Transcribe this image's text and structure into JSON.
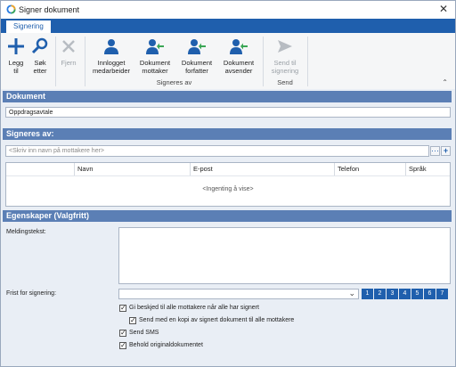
{
  "window": {
    "title": "Signer dokument",
    "close_glyph": "✕"
  },
  "tab": {
    "label": "Signering"
  },
  "ribbon": {
    "buttons": [
      {
        "label": "Legg\ntil",
        "icon": "plus-icon",
        "enabled": true
      },
      {
        "label": "Søk\netter",
        "icon": "search-icon",
        "enabled": true
      },
      {
        "label": "Fjern",
        "icon": "remove-icon",
        "enabled": false
      },
      {
        "label": "Innlogget\nmedarbeider",
        "icon": "user-icon",
        "enabled": true
      },
      {
        "label": "Dokument\nmottaker",
        "icon": "user-arrow-icon",
        "enabled": true
      },
      {
        "label": "Dokument\nforfatter",
        "icon": "user-arrow-icon",
        "enabled": true
      },
      {
        "label": "Dokument\navsender",
        "icon": "user-arrow-icon",
        "enabled": true
      },
      {
        "label": "Send til\nsignering",
        "icon": "send-icon",
        "enabled": false
      }
    ],
    "groups": {
      "signeres_av": "Signeres av",
      "send": "Send"
    },
    "collapse_glyph": "⌃"
  },
  "sections": {
    "dokument": {
      "title": "Dokument",
      "value": "Oppdragsavtale"
    },
    "signeres": {
      "title": "Signeres av:",
      "placeholder": "<Skriv inn navn på mottakere her>",
      "more_glyph": "···",
      "add_glyph": "+",
      "columns": [
        "Navn",
        "E-post",
        "Telefon",
        "Språk"
      ],
      "empty_text": "<Ingenting å vise>"
    },
    "egenskaper": {
      "title": "Egenskaper (Valgfritt)",
      "message_label": "Meldingstekst:",
      "message_value": "",
      "deadline_label": "Frist for signering:",
      "deadline_value": "",
      "dropdown_glyph": "⌄",
      "day_buttons": [
        "1",
        "2",
        "3",
        "4",
        "5",
        "6",
        "7"
      ],
      "checkboxes": [
        {
          "label": "Gi beskjed til alle mottakere når alle har signert",
          "checked": true
        },
        {
          "label": "Send med en kopi av signert dokument til alle mottakere",
          "checked": true
        },
        {
          "label": "Send SMS",
          "checked": true
        },
        {
          "label": "Behold originaldokumentet",
          "checked": true
        }
      ]
    }
  },
  "colors": {
    "accent": "#1f5fad",
    "section_header": "#5b7fb5",
    "panel_bg": "#e9eef5",
    "icon_blue": "#1f5fad",
    "arrow_green": "#3aa655"
  }
}
